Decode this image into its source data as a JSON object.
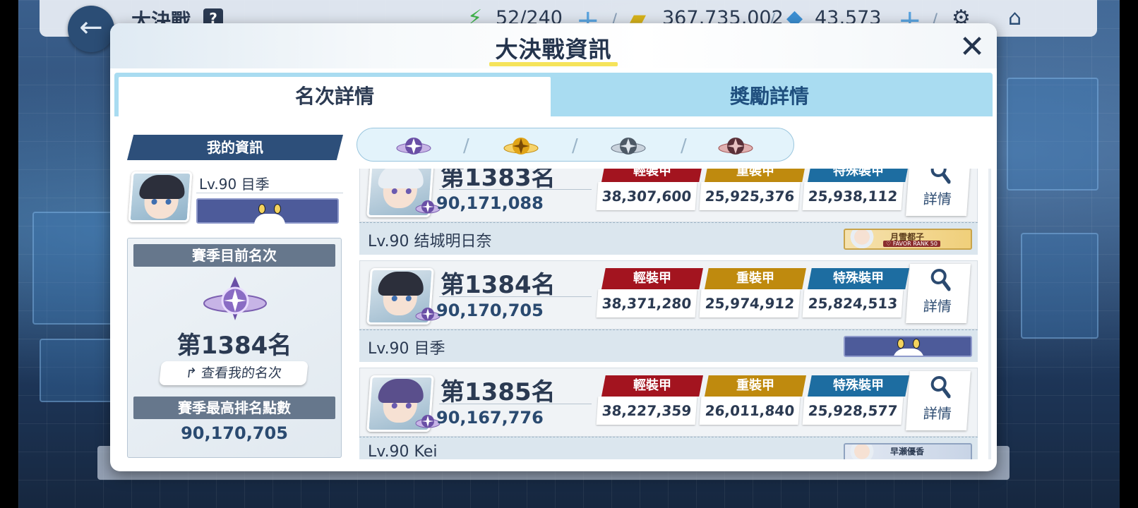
{
  "background": {
    "screen_title": "大決戰",
    "help_glyph": "?",
    "back_glyph": "←",
    "stamina": "52/240",
    "credits": "367,735,002",
    "gems": "43,573",
    "plus_glyph": "+",
    "separator": "/",
    "icons": [
      "back-arrow-icon",
      "help-icon",
      "stamina-bolt-icon",
      "credit-card-icon",
      "pyroxene-icon",
      "gear-icon",
      "home-icon"
    ]
  },
  "modal": {
    "title": "大決戰資訊",
    "close_glyph": "✕"
  },
  "tabs": [
    {
      "label": "名次詳情",
      "active": true
    },
    {
      "label": "獎勵詳情",
      "active": false
    }
  ],
  "my_info": {
    "section_label": "我的資訊",
    "level_name": "Lv.90 目季",
    "season_rank_label": "賽季目前名次",
    "season_rank": "第1384名",
    "view_my_rank_button": "查看我的名次",
    "view_my_rank_icon": "↱",
    "best_score_label": "賽季最高排名點數",
    "best_score": "90,170,705"
  },
  "tier_filter": {
    "tiers": [
      "platinum-tier-icon",
      "gold-tier-icon",
      "silver-tier-icon",
      "bronze-tier-icon"
    ],
    "separator": "/",
    "colors": {
      "platinum": "#7b5fb0",
      "gold": "#e0a418",
      "silver": "#6b7888",
      "bronze": "#a05252"
    }
  },
  "armor_colors": {
    "light": "#a3141f",
    "heavy": "#bf8a0e",
    "special": "#1d6da1"
  },
  "armor_headers": {
    "light": "輕裝甲",
    "heavy": "重裝甲",
    "special": "特殊裝甲"
  },
  "detail_label": "詳情",
  "ranking": [
    {
      "rank": "第1383名",
      "score": "90,171,088",
      "light": "38,307,600",
      "heavy": "25,925,376",
      "special": "25,938,112",
      "name": "Lv.90  结城明日奈",
      "favor_name": "月雪都子",
      "favor_sub": "♡ FAVOR RANK 50"
    },
    {
      "rank": "第1384名",
      "score": "90,170,705",
      "light": "38,371,280",
      "heavy": "25,974,912",
      "special": "25,824,513",
      "name": "Lv.90  目季"
    },
    {
      "rank": "第1385名",
      "score": "90,167,776",
      "light": "38,227,359",
      "heavy": "26,011,840",
      "special": "25,928,577",
      "name": "Lv.90  Kei",
      "favor_name": "早瀬優香"
    }
  ]
}
